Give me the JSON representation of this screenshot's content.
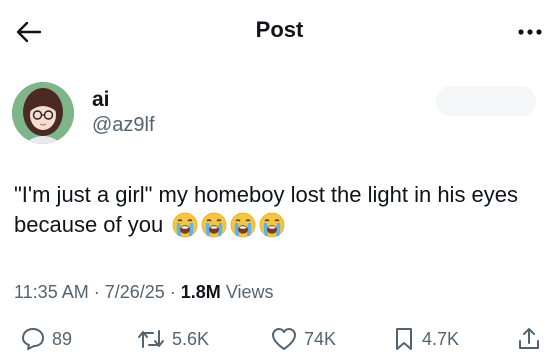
{
  "header": {
    "title": "Post"
  },
  "author": {
    "name": "ai",
    "handle": "@az9lf"
  },
  "post": {
    "text": "\"I'm just a girl\" my homeboy lost the light in his eyes because of you",
    "emoji_count": 4,
    "emoji": "loudly-crying-face"
  },
  "meta": {
    "time": "11:35 AM",
    "sep1": " · ",
    "date": "7/26/25",
    "sep2": " · ",
    "views_count": "1.8M",
    "views_label": " Views"
  },
  "actions": {
    "replies": "89",
    "reposts": "5.6K",
    "likes": "74K",
    "bookmarks": "4.7K"
  },
  "icons": [
    "back-arrow-icon",
    "more-icon",
    "reply-icon",
    "repost-icon",
    "like-icon",
    "bookmark-icon",
    "share-icon"
  ]
}
